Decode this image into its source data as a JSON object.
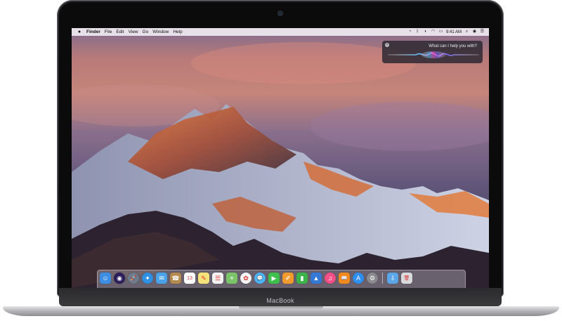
{
  "device": {
    "brand_label": "MacBook"
  },
  "menubar": {
    "app_name": "Finder",
    "items": [
      "File",
      "Edit",
      "View",
      "Go",
      "Window",
      "Help"
    ],
    "status_icons": [
      "battery-charging-icon",
      "bluetooth-icon",
      "volume-icon",
      "wifi-icon",
      "battery-icon",
      "airplay-icon"
    ],
    "clock": "9:41 AM",
    "trailing_icons": [
      "spotlight-search-icon",
      "siri-icon",
      "notification-center-icon"
    ]
  },
  "siri": {
    "prompt": "What can I help you with?"
  },
  "dock": {
    "apps": [
      {
        "name": "finder",
        "color": "#3b8ee3",
        "glyph": "☺"
      },
      {
        "name": "siri",
        "color": "#2a1f5a",
        "glyph": "◉"
      },
      {
        "name": "launchpad",
        "color": "#6e7b8c",
        "glyph": "🚀"
      },
      {
        "name": "safari",
        "color": "#2f8fe0",
        "glyph": "✦"
      },
      {
        "name": "mail",
        "color": "#4aa3e8",
        "glyph": "✉"
      },
      {
        "name": "contacts",
        "color": "#b58a4e",
        "glyph": "☎"
      },
      {
        "name": "calendar",
        "color": "#ffffff",
        "glyph": "13"
      },
      {
        "name": "notes",
        "color": "#f6e27a",
        "glyph": "✎"
      },
      {
        "name": "reminders",
        "color": "#f2f2f2",
        "glyph": "☰"
      },
      {
        "name": "maps",
        "color": "#7bc46a",
        "glyph": "⌖"
      },
      {
        "name": "photos",
        "color": "#f5f5f5",
        "glyph": "✿"
      },
      {
        "name": "messages",
        "color": "#4cb4f5",
        "glyph": "💬"
      },
      {
        "name": "facetime",
        "color": "#3fbf4c",
        "glyph": "▶"
      },
      {
        "name": "pages",
        "color": "#f09a2e",
        "glyph": "✐"
      },
      {
        "name": "numbers",
        "color": "#3bb34a",
        "glyph": "▮"
      },
      {
        "name": "keynote",
        "color": "#3578d6",
        "glyph": "▲"
      },
      {
        "name": "itunes",
        "color": "#f24f86",
        "glyph": "♫"
      },
      {
        "name": "ibooks",
        "color": "#f08a1e",
        "glyph": "📖"
      },
      {
        "name": "app-store",
        "color": "#2f8ff0",
        "glyph": "A"
      },
      {
        "name": "system-preferences",
        "color": "#8a8a8e",
        "glyph": "⚙"
      }
    ],
    "trailing": [
      {
        "name": "downloads-folder",
        "color": "#5aa6e8",
        "glyph": "⇩"
      },
      {
        "name": "trash",
        "color": "#d8dadc",
        "glyph": "🗑"
      }
    ]
  }
}
